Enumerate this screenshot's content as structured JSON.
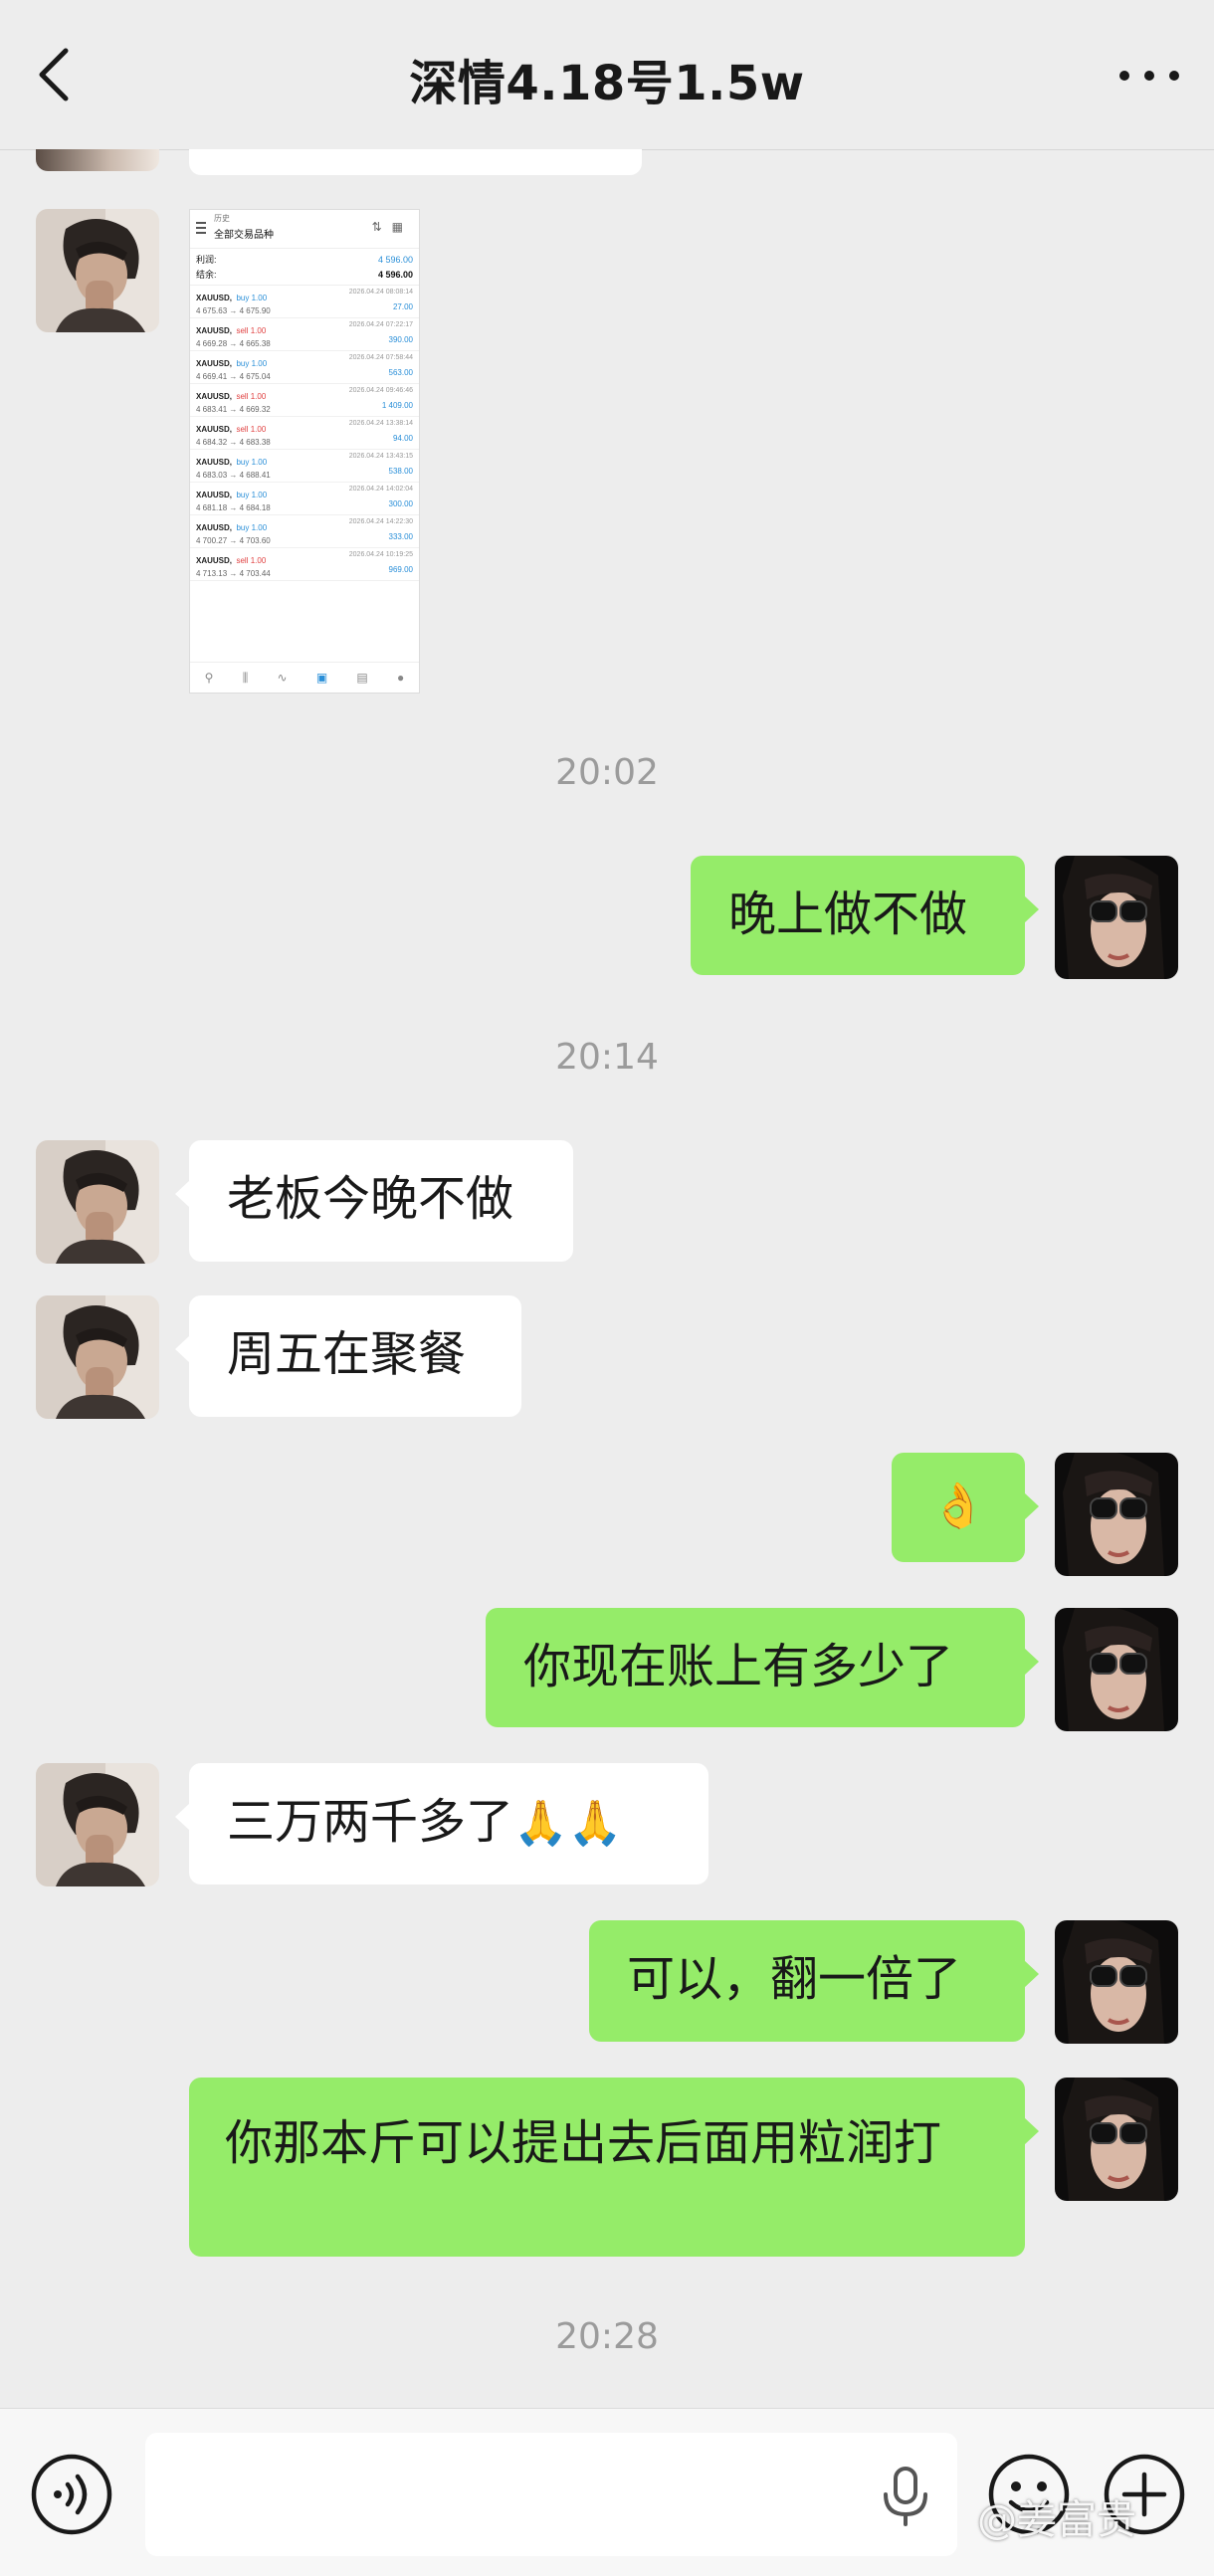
{
  "header": {
    "title": "深情4.18号1.5w",
    "icons": {
      "back": "back-icon",
      "more": "more-icon"
    }
  },
  "screenshot_thumb": {
    "header_small": "历史",
    "header_title": "全部交易品种",
    "summary": [
      {
        "label": "利润:",
        "value": "4 596.00"
      },
      {
        "label": "结余:",
        "value": "4 596.00"
      }
    ],
    "trades": [
      {
        "symbol": "XAUUSD,",
        "side": "buy 1.00",
        "dir": "buy",
        "prices": "4 675.63 → 4 675.90",
        "date": "2026.04.24 08:08:14",
        "profit": "27.00"
      },
      {
        "symbol": "XAUUSD,",
        "side": "sell 1.00",
        "dir": "sell",
        "prices": "4 669.28 → 4 665.38",
        "date": "2026.04.24 07:22:17",
        "profit": "390.00"
      },
      {
        "symbol": "XAUUSD,",
        "side": "buy 1.00",
        "dir": "buy",
        "prices": "4 669.41 → 4 675.04",
        "date": "2026.04.24 07:58:44",
        "profit": "563.00"
      },
      {
        "symbol": "XAUUSD,",
        "side": "sell 1.00",
        "dir": "sell",
        "prices": "4 683.41 → 4 669.32",
        "date": "2026.04.24 09:46:46",
        "profit": "1 409.00"
      },
      {
        "symbol": "XAUUSD,",
        "side": "sell 1.00",
        "dir": "sell",
        "prices": "4 684.32 → 4 683.38",
        "date": "2026.04.24 13:38:14",
        "profit": "94.00"
      },
      {
        "symbol": "XAUUSD,",
        "side": "buy 1.00",
        "dir": "buy",
        "prices": "4 683.03 → 4 688.41",
        "date": "2026.04.24 13:43:15",
        "profit": "538.00"
      },
      {
        "symbol": "XAUUSD,",
        "side": "buy 1.00",
        "dir": "buy",
        "prices": "4 681.18 → 4 684.18",
        "date": "2026.04.24 14:02:04",
        "profit": "300.00"
      },
      {
        "symbol": "XAUUSD,",
        "side": "buy 1.00",
        "dir": "buy",
        "prices": "4 700.27 → 4 703.60",
        "date": "2026.04.24 14:22:30",
        "profit": "333.00"
      },
      {
        "symbol": "XAUUSD,",
        "side": "sell 1.00",
        "dir": "sell",
        "prices": "4 713.13 → 4 703.44",
        "date": "2026.04.24 10:19:25",
        "profit": "969.00"
      }
    ]
  },
  "messages": {
    "time_1": "20:02",
    "out_1": "晚上做不做",
    "time_2": "20:14",
    "in_1": "老板今晚不做",
    "in_2": "周五在聚餐",
    "out_2_emoji": "👌",
    "out_3": "你现在账上有多少了",
    "in_3": "三万两千多了",
    "in_3_emoji": "🙏🙏",
    "out_4": "可以，翻一倍了",
    "out_5": "你那本斤可以提出去后面用粒润打",
    "time_3": "20:28"
  },
  "input_bar": {
    "placeholder": "",
    "icons": {
      "voice": "voice-icon",
      "mic": "mic-icon",
      "emoji": "emoji-icon",
      "plus": "plus-icon"
    }
  },
  "watermark": "@姜富贵",
  "colors": {
    "background": "#ededed",
    "outgoing_bubble": "#95ec69",
    "incoming_bubble": "#ffffff",
    "timestamp": "#9b9b9b"
  }
}
